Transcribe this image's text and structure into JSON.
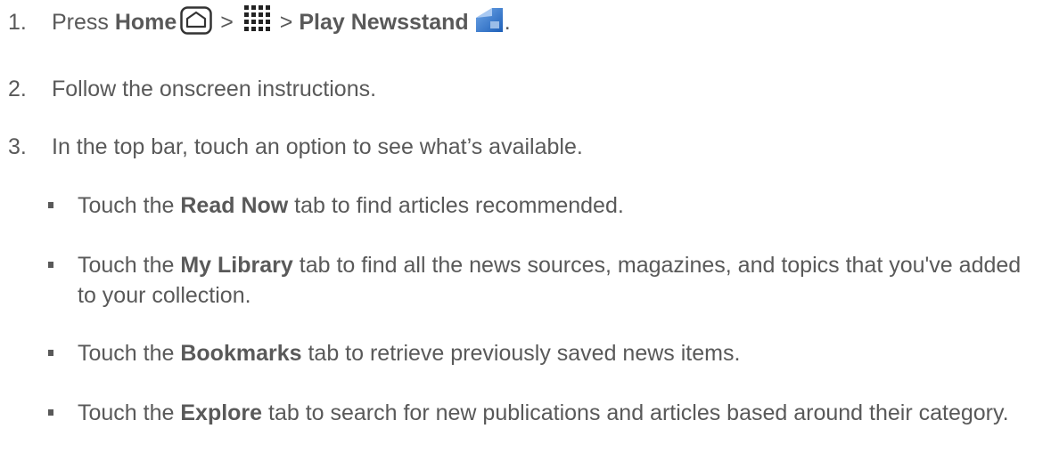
{
  "steps": [
    {
      "number": "1.",
      "parts": {
        "press": "Press ",
        "home": "Home",
        "sep1": " > ",
        "sep2": " > ",
        "newsstand": "Play Newsstand",
        "end": "."
      }
    },
    {
      "number": "2.",
      "text": "Follow the onscreen instructions."
    },
    {
      "number": "3.",
      "text": "In the top bar, touch an option to see what’s available."
    }
  ],
  "bullets": [
    {
      "pre": "Touch the ",
      "bold": "Read Now",
      "post": " tab to find articles recommended."
    },
    {
      "pre": "Touch the ",
      "bold": "My Library",
      "post": " tab to find all the news sources, magazines, and topics that you've added to your collection."
    },
    {
      "pre": "Touch the ",
      "bold": "Bookmarks",
      "post": " tab to retrieve previously saved news items."
    },
    {
      "pre": "Touch the ",
      "bold": "Explore",
      "post": " tab to search for new publications and articles based around their category."
    }
  ],
  "icons": {
    "home": "home-icon",
    "apps": "apps-grid-icon",
    "newsstand": "play-newsstand-icon"
  },
  "colors": {
    "text": "#595959",
    "newsstand_blue": "#2f6fc4"
  }
}
